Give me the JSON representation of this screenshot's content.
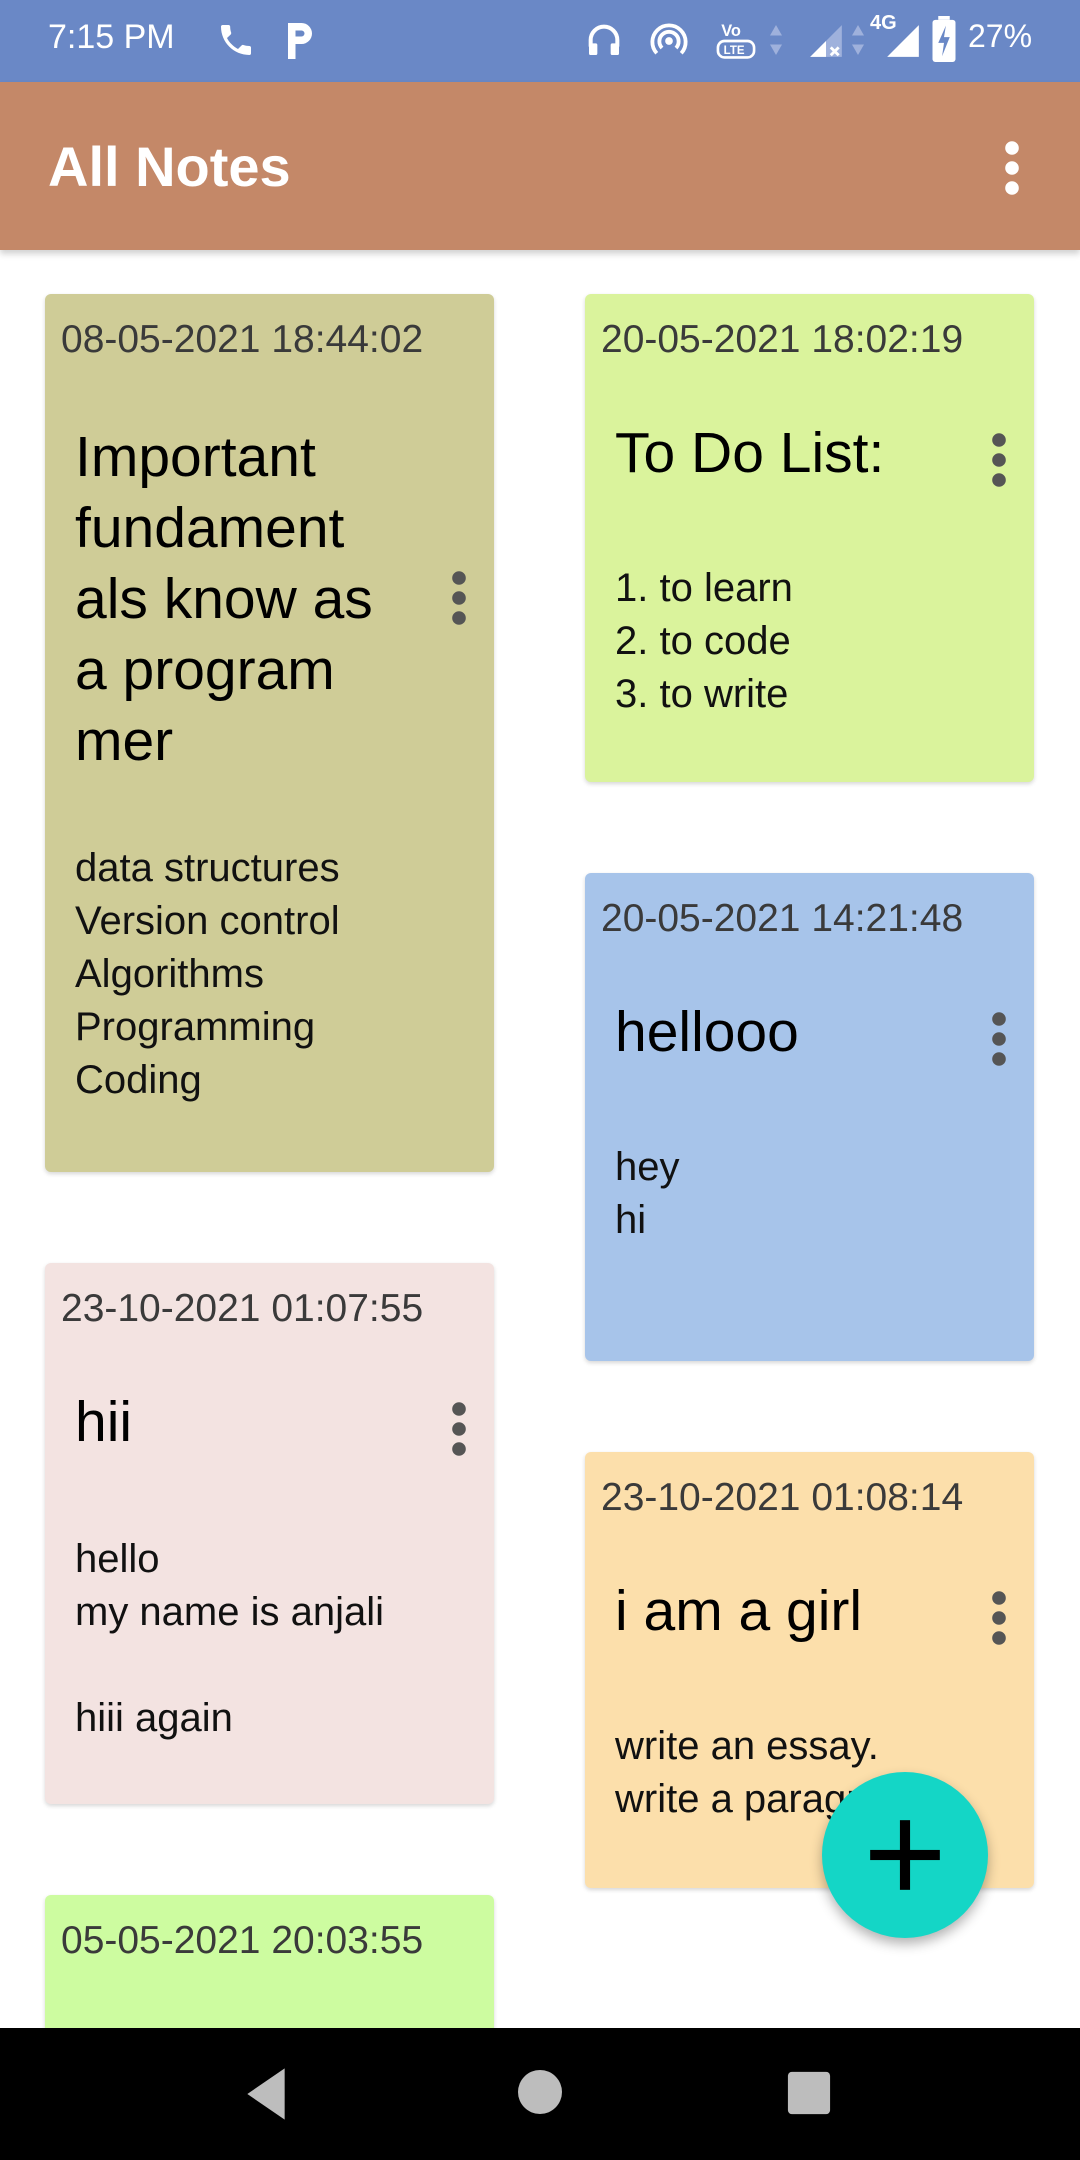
{
  "status_bar": {
    "time": "7:15 PM",
    "network_type": "4G",
    "battery": "27%",
    "icons": [
      "phone-icon",
      "parking-icon",
      "headphones-icon",
      "hotspot-icon",
      "volte-icon",
      "signal-icon",
      "battery-icon"
    ]
  },
  "app_bar": {
    "title": "All Notes",
    "menu_icon": "more-vert-icon"
  },
  "notes": [
    {
      "date": "08-05-2021 18:44:02",
      "title": "Important fundament als know as a program mer",
      "body": "data structures\nVersion control\nAlgorithms\nProgramming\nCoding",
      "color": "#cfcc97"
    },
    {
      "date": "20-05-2021 18:02:19",
      "title": "To Do List:",
      "body": "1. to learn\n2. to code\n3. to write",
      "color": "#daf39c"
    },
    {
      "date": "20-05-2021 14:21:48",
      "title": "hellooo",
      "body": "hey\nhi",
      "color": "#a7c4ea"
    },
    {
      "date": "23-10-2021 01:07:55",
      "title": "hii",
      "body": "hello\nmy name is anjali\n\nhiii again",
      "color": "#f3e3e1"
    },
    {
      "date": "23-10-2021 01:08:14",
      "title": "i am a girl",
      "body": "write an essay.\nwrite a paragraph",
      "color": "#fcdfab"
    },
    {
      "date": "05-05-2021 20:03:55",
      "title": "",
      "body": "",
      "color": "#cdfca0"
    }
  ],
  "fab": {
    "icon": "plus-icon",
    "color": "#14d6c6"
  },
  "nav_bar": {
    "icons": [
      "back-icon",
      "home-icon",
      "recents-icon"
    ]
  }
}
